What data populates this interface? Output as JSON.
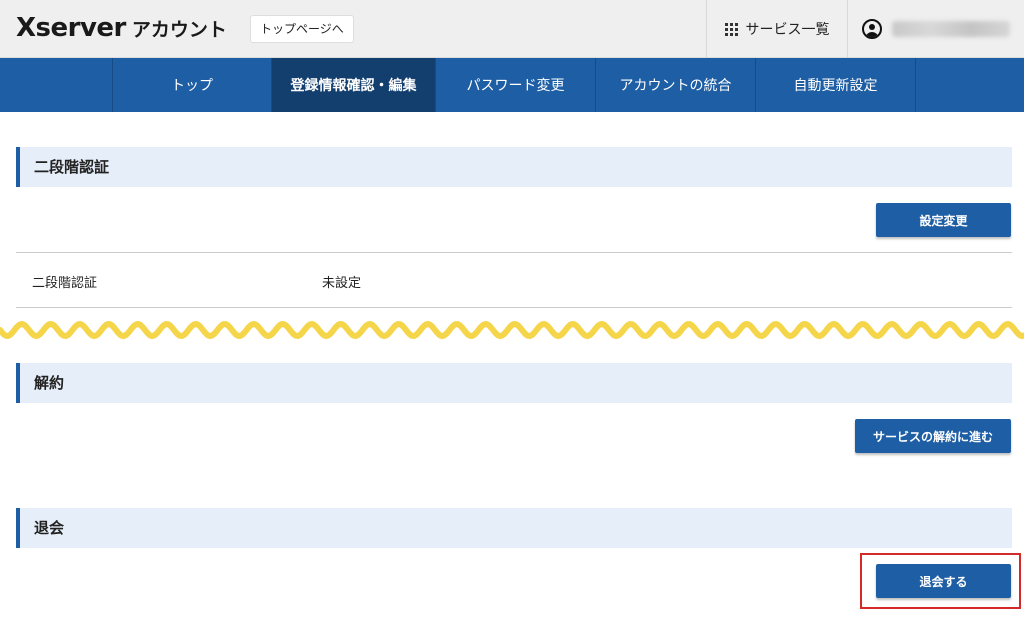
{
  "header": {
    "logo_brand": "Xserver",
    "logo_suffix": "アカウント",
    "top_page_link": "トップページへ",
    "services_label": "サービス一覧"
  },
  "nav": {
    "items": [
      {
        "label": "トップ",
        "active": false
      },
      {
        "label": "登録情報確認・編集",
        "active": true
      },
      {
        "label": "パスワード変更",
        "active": false
      },
      {
        "label": "アカウントの統合",
        "active": false
      },
      {
        "label": "自動更新設定",
        "active": false
      }
    ]
  },
  "two_factor": {
    "title": "二段階認証",
    "button": "設定変更",
    "row_label": "二段階認証",
    "row_value": "未設定"
  },
  "cancel": {
    "title": "解約",
    "button": "サービスの解約に進む"
  },
  "withdraw": {
    "title": "退会",
    "button": "退会する"
  },
  "colors": {
    "primary": "#1e5ea5",
    "nav_active": "#133f6f",
    "section_bg": "#e6eef9",
    "wave": "#f5d54a",
    "highlight": "#d42a2a"
  }
}
